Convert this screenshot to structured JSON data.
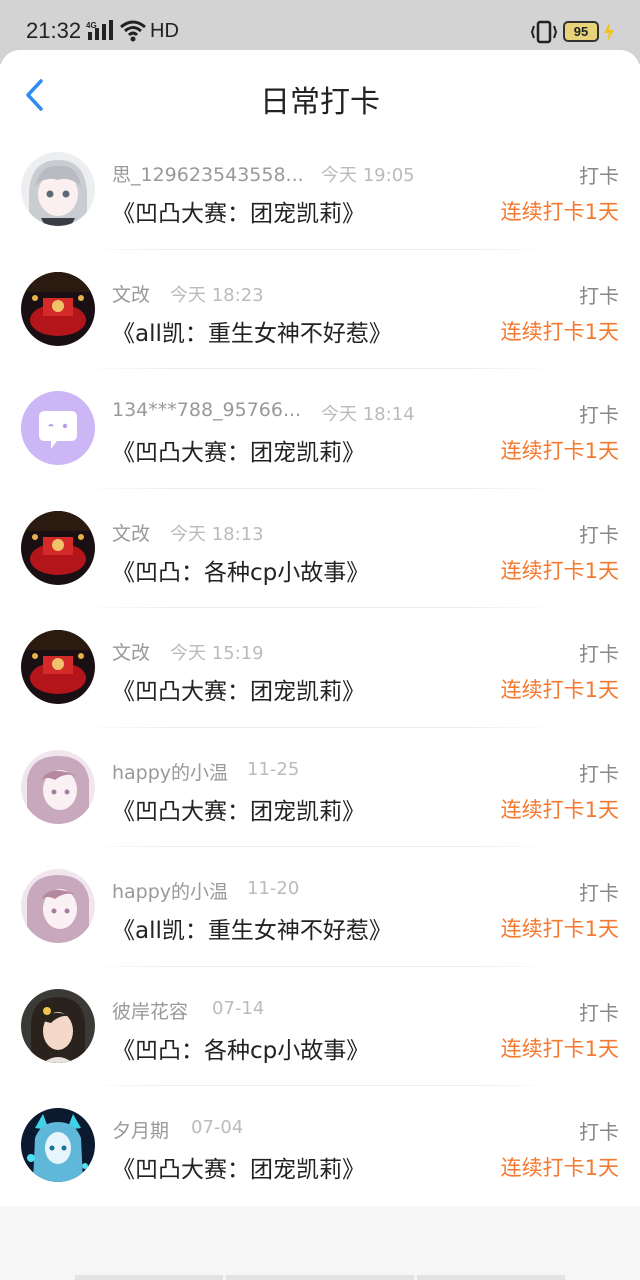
{
  "status_bar": {
    "time": "21:32",
    "network": "4G",
    "hd": "HD",
    "battery": "95"
  },
  "header": {
    "title": "日常打卡"
  },
  "records": [
    {
      "user": "思_129623543558...",
      "time": "今天 19:05",
      "book": "《凹凸大赛：团宠凯莉》",
      "action": "打卡",
      "streak": "连续打卡1天",
      "avatar": "anime-girl-gray"
    },
    {
      "user": "文改",
      "time": "今天 18:23",
      "book": "《all凯：重生女神不好惹》",
      "action": "打卡",
      "streak": "连续打卡1天",
      "avatar": "red-scene"
    },
    {
      "user": "134***788_95766...",
      "time": "今天 18:14",
      "book": "《凹凸大赛：团宠凯莉》",
      "action": "打卡",
      "streak": "连续打卡1天",
      "avatar": "chat-bubble-purple"
    },
    {
      "user": "文改",
      "time": "今天 18:13",
      "book": "《凹凸：各种cp小故事》",
      "action": "打卡",
      "streak": "连续打卡1天",
      "avatar": "red-scene"
    },
    {
      "user": "文改",
      "time": "今天 15:19",
      "book": "《凹凸大赛：团宠凯莉》",
      "action": "打卡",
      "streak": "连续打卡1天",
      "avatar": "red-scene"
    },
    {
      "user": "happy的小温",
      "time": "11-25",
      "book": "《凹凸大赛：团宠凯莉》",
      "action": "打卡",
      "streak": "连续打卡1天",
      "avatar": "anime-girl-pink"
    },
    {
      "user": "happy的小温",
      "time": "11-20",
      "book": "《all凯：重生女神不好惹》",
      "action": "打卡",
      "streak": "连续打卡1天",
      "avatar": "anime-girl-pink"
    },
    {
      "user": "彼岸花容",
      "time": "07-14",
      "book": "《凹凸：各种cp小故事》",
      "action": "打卡",
      "streak": "连续打卡1天",
      "avatar": "photo-girl"
    },
    {
      "user": "夕月期",
      "time": "07-04",
      "book": "《凹凸大赛：团宠凯莉》",
      "action": "打卡",
      "streak": "连续打卡1天",
      "avatar": "anime-blue-glow"
    }
  ],
  "colors": {
    "accent_blue": "#2f8cf0",
    "streak_orange": "#f5782f",
    "status_bar_bg": "#d3d3d3"
  }
}
